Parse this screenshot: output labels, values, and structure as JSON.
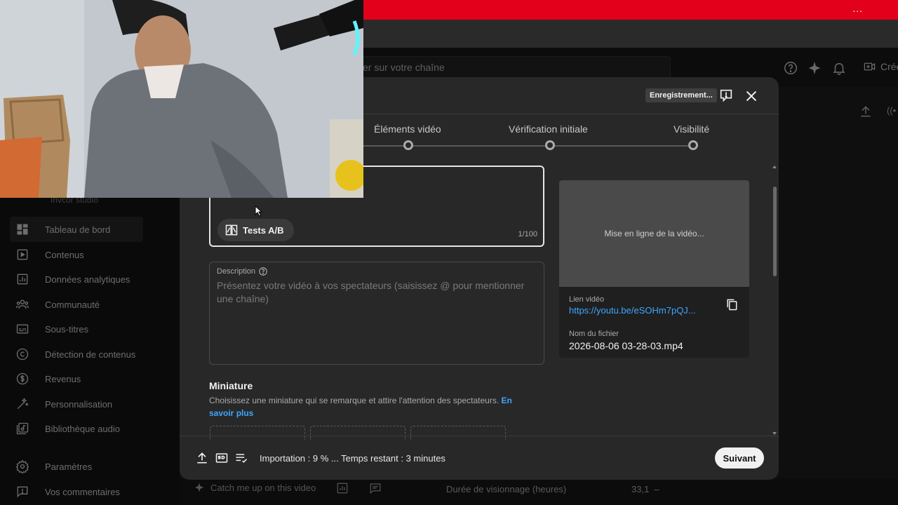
{
  "browser": {
    "menu_dots": "..."
  },
  "header": {
    "search_placeholder": "er sur votre chaîne",
    "create_label": "Créer"
  },
  "sidebar": {
    "channel_sub": "Invcor studio",
    "items": [
      {
        "label": "Tableau de bord",
        "icon": "dashboard-icon",
        "active": true
      },
      {
        "label": "Contenus",
        "icon": "content-icon"
      },
      {
        "label": "Données analytiques",
        "icon": "analytics-icon"
      },
      {
        "label": "Communauté",
        "icon": "community-icon"
      },
      {
        "label": "Sous-titres",
        "icon": "subtitles-icon"
      },
      {
        "label": "Détection de contenus",
        "icon": "copyright-icon"
      },
      {
        "label": "Revenus",
        "icon": "earn-icon"
      },
      {
        "label": "Personnalisation",
        "icon": "customization-icon"
      },
      {
        "label": "Bibliothèque audio",
        "icon": "audio-library-icon"
      },
      {
        "label": "Paramètres",
        "icon": "settings-icon"
      },
      {
        "label": "Vos commentaires",
        "icon": "feedback-icon"
      }
    ]
  },
  "background": {
    "catch_me_up": "Catch me up on this video",
    "watch_time_label": "Durée de visionnage (heures)",
    "watch_time_value": "33,1",
    "watch_time_dash": "–"
  },
  "modal": {
    "saving_badge": "Enregistrement...",
    "steps": [
      {
        "label": "Éléments vidéo"
      },
      {
        "label": "Vérification initiale"
      },
      {
        "label": "Visibilité"
      }
    ],
    "title_field": {
      "ab_button": "Tests A/B",
      "char_count": "1/100"
    },
    "description": {
      "label": "Description",
      "placeholder": "Présentez votre vidéo à vos spectateurs (saisissez @ pour mentionner une chaîne)"
    },
    "thumbnail": {
      "title": "Miniature",
      "desc": "Choisissez une miniature qui se remarque et attire l'attention des spectateurs.",
      "link": "En savoir plus"
    },
    "preview": {
      "status": "Mise en ligne de la vidéo...",
      "link_label": "Lien vidéo",
      "link_url": "https://youtu.be/eSOHm7pQJ...",
      "file_label": "Nom du fichier",
      "file_name": "2026-08-06 03-28-03.mp4"
    },
    "footer": {
      "status": "Importation : 9 % ... Temps restant : 3 minutes",
      "progress_percent": 9,
      "next_button": "Suivant"
    }
  },
  "colors": {
    "accent_link": "#3ea6ff",
    "brand_red": "#e2001a",
    "modal_bg": "#282828"
  }
}
